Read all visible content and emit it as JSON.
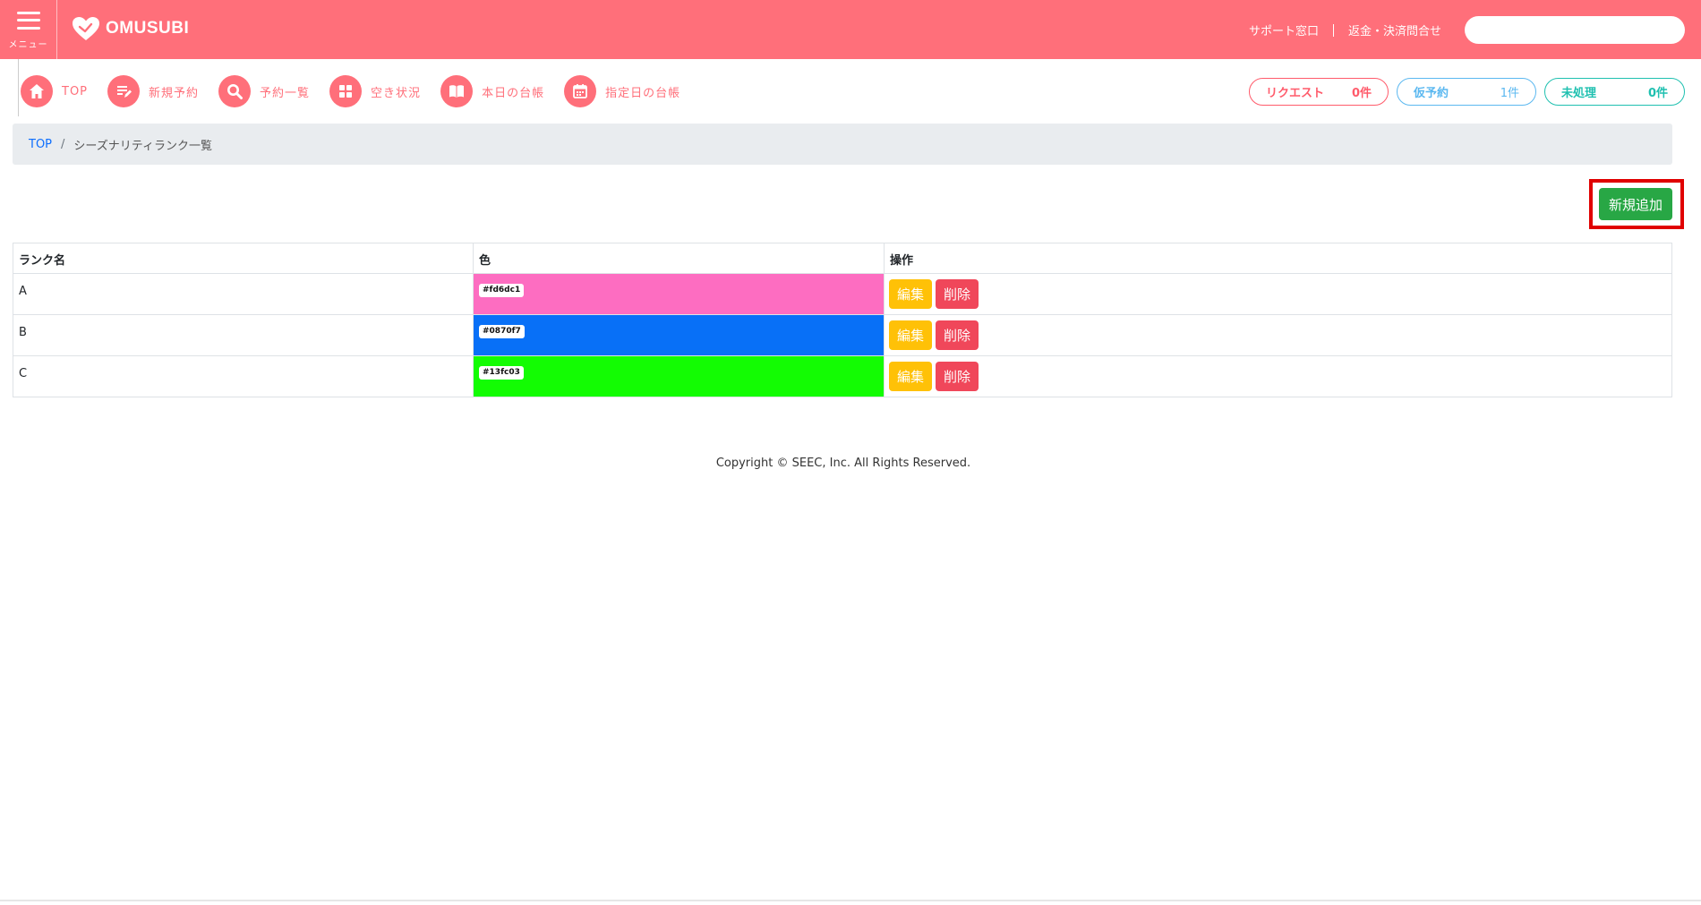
{
  "header": {
    "menu_label": "メニュー",
    "logo_text": "OMUSUBI",
    "links": [
      "サポート窓口",
      "返金・決済問合せ"
    ],
    "search_value": "",
    "brand_color": "#ff6f7a"
  },
  "nav": {
    "items": [
      {
        "label": "TOP",
        "icon": "home-icon"
      },
      {
        "label": "新規予約",
        "icon": "new-reservation-icon"
      },
      {
        "label": "予約一覧",
        "icon": "search-icon"
      },
      {
        "label": "空き状況",
        "icon": "grid-icon"
      },
      {
        "label": "本日の台帳",
        "icon": "book-icon"
      },
      {
        "label": "指定日の台帳",
        "icon": "calendar-icon"
      }
    ],
    "status": [
      {
        "label": "リクエスト",
        "count": "0件"
      },
      {
        "label": "仮予約",
        "count": "1件"
      },
      {
        "label": "未処理",
        "count": "0件"
      }
    ]
  },
  "breadcrumb": {
    "home": "TOP",
    "separator": "/",
    "current": "シーズナリティランク一覧"
  },
  "add_button": "新規追加",
  "table": {
    "headers": [
      "ランク名",
      "色",
      "操作"
    ],
    "edit_label": "編集",
    "delete_label": "削除",
    "rows": [
      {
        "name": "A",
        "color": "#fd6dc1"
      },
      {
        "name": "B",
        "color": "#0870f7"
      },
      {
        "name": "C",
        "color": "#13fc03"
      }
    ]
  },
  "footer": "Copyright © SEEC, Inc. All Rights Reserved."
}
